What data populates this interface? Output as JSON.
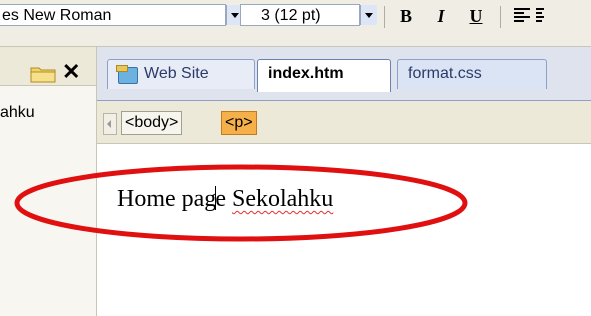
{
  "toolbar": {
    "font_name": "es New Roman",
    "font_size": "3  (12 pt)",
    "bold": "B",
    "italic": "I",
    "underline": "U"
  },
  "left_panel": {
    "item": "ahku"
  },
  "tabs": [
    {
      "label": "Web Site"
    },
    {
      "label": "index.htm"
    },
    {
      "label": "format.css"
    }
  ],
  "tagbar": {
    "body_tag": "<body>",
    "p_tag": "<p>"
  },
  "editor": {
    "text_before_caret": "Home pag",
    "text_after_caret": "e",
    "space": " ",
    "misspelled_word": "Sekolahku"
  },
  "colors": {
    "highlight_ellipse": "#e01010",
    "selected_tag": "#f6b04a"
  }
}
